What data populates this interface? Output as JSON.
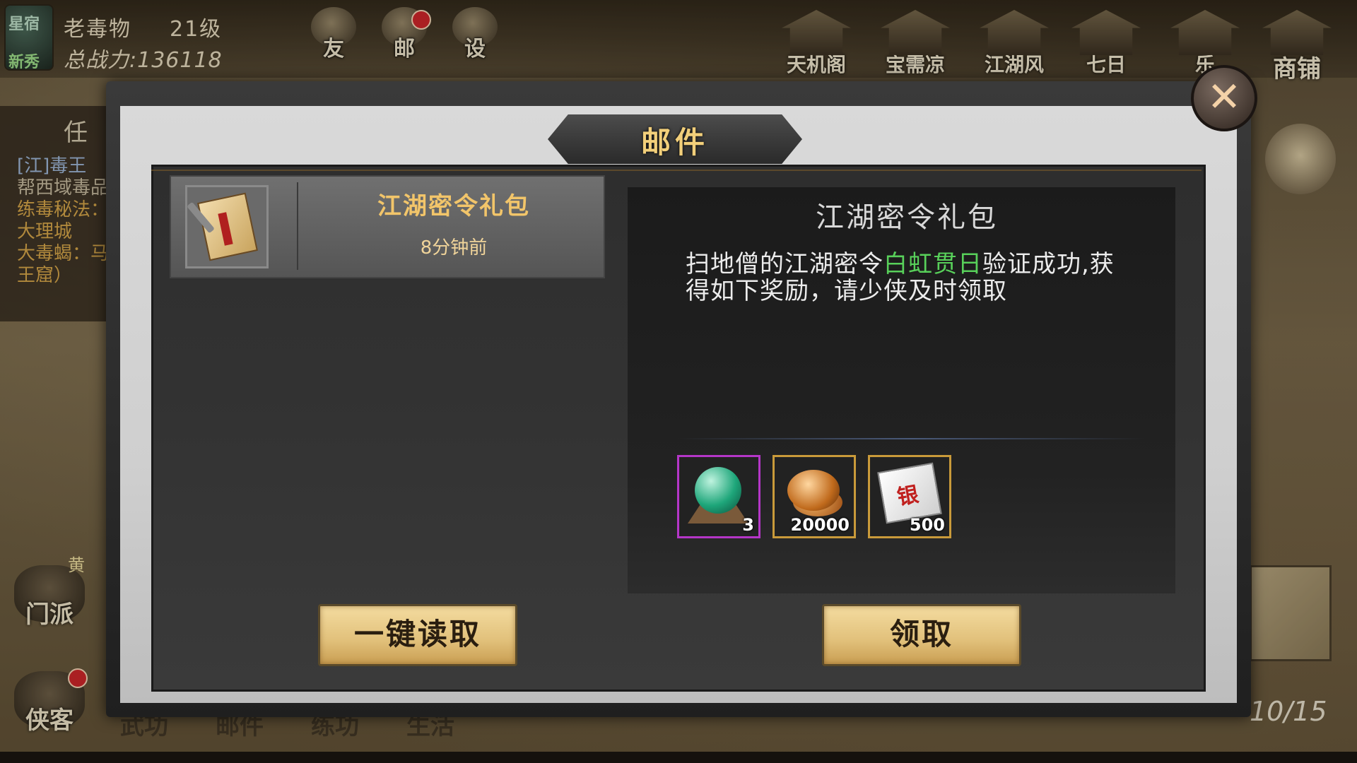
{
  "player": {
    "rank_badge": "星宿",
    "tier_badge": "新秀",
    "name": "老毒物",
    "level": "21级",
    "power": "总战力:136118"
  },
  "top_icons": [
    {
      "label": "友",
      "icon": "friends-icon"
    },
    {
      "label": "邮",
      "icon": "mail-icon"
    },
    {
      "label": "设",
      "icon": "gear-icon"
    }
  ],
  "right_menu": [
    {
      "label": "天机阁"
    },
    {
      "label": "宝需凉"
    },
    {
      "label": "江湖风云"
    },
    {
      "label": "七日"
    },
    {
      "label": "乐"
    },
    {
      "label": "商铺"
    }
  ],
  "side": {
    "title": "任",
    "quest_lines": [
      "[江]毒王",
      "帮西域毒品",
      "练毒秘法：大理城",
      "大毒蝎：马王窟）"
    ]
  },
  "bottom_left": [
    {
      "label": "门派",
      "badge": "黄"
    },
    {
      "label": "侠客"
    }
  ],
  "bottom_tabs": [
    "武功",
    "邮件",
    "练功",
    "生活"
  ],
  "progress": "10/15",
  "modal": {
    "title": "邮件",
    "close_label": "✕",
    "mail_list": [
      {
        "title": "江湖密令礼包",
        "time": "8分钟前"
      }
    ],
    "detail": {
      "title": "江湖密令礼包",
      "body_prefix": "扫地僧的江湖密令",
      "body_highlight": "白虹贯日",
      "body_suffix": "验证成功,获得如下奖励，请少侠及时领取",
      "highlight_color": "#58d05a"
    },
    "rewards": [
      {
        "item": "jade-orb",
        "qty": "3",
        "rarity": "purple"
      },
      {
        "item": "copper-coins",
        "qty": "20000",
        "rarity": "gold"
      },
      {
        "item": "silver-note",
        "qty": "500",
        "rarity": "gold",
        "mark": "银"
      }
    ],
    "buttons": {
      "read_all": "一键读取",
      "claim": "领取"
    }
  }
}
